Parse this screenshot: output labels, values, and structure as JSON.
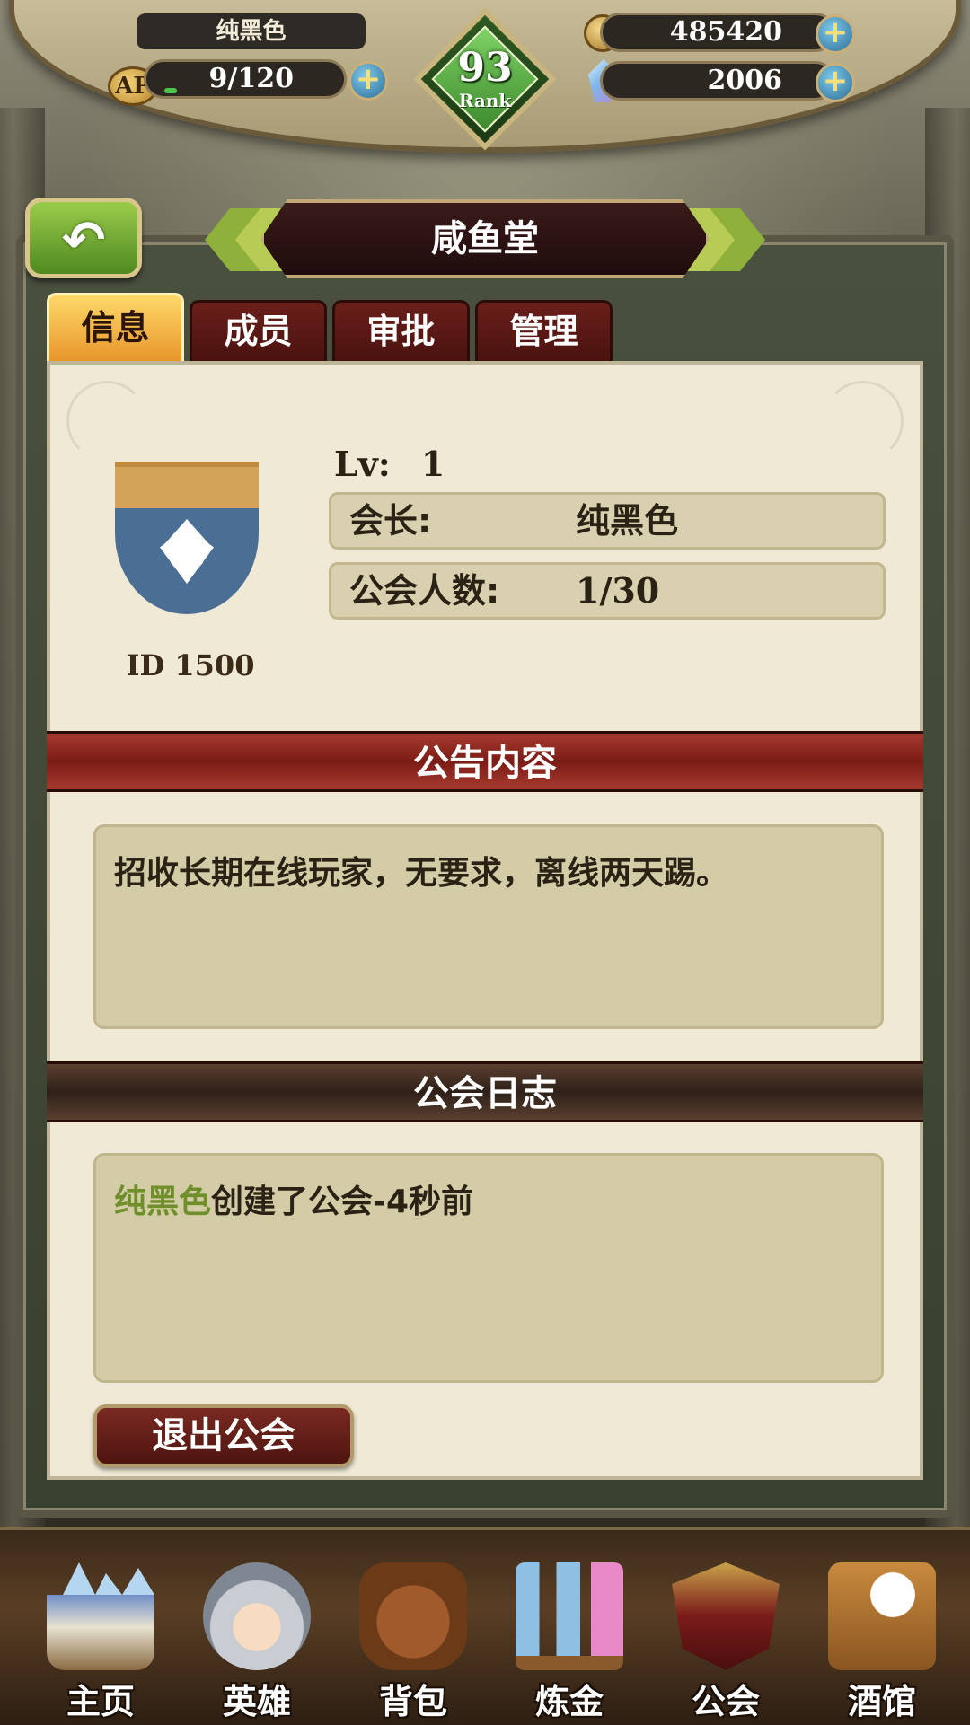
{
  "hud": {
    "player_name": "纯黑色",
    "ap_label": "AP",
    "ap_value": "9/120",
    "ap_fill_fraction": 0.075,
    "rank_number": "93",
    "rank_label": "Rank",
    "gold": "485420",
    "gems": "2006",
    "plus_symbol": "+"
  },
  "header": {
    "back_symbol": "↶",
    "title": "咸鱼堂"
  },
  "tabs": [
    {
      "label": "信息",
      "active": true
    },
    {
      "label": "成员",
      "active": false
    },
    {
      "label": "审批",
      "active": false
    },
    {
      "label": "管理",
      "active": false
    }
  ],
  "guild": {
    "id_text": "ID 1500",
    "level_label": "Lv:",
    "level_value": "1",
    "leader_label": "会长:",
    "leader_value": "纯黑色",
    "members_label": "公会人数:",
    "members_value": "1/30"
  },
  "notice": {
    "heading": "公告内容",
    "text": "招收长期在线玩家，无要求，离线两天踢。"
  },
  "log": {
    "heading": "公会日志",
    "entries": [
      {
        "user": "纯黑色",
        "text": "创建了公会-4秒前"
      }
    ]
  },
  "actions": {
    "quit_label": "退出公会"
  },
  "bottom_nav": [
    {
      "label": "主页",
      "icon": "castle-icon"
    },
    {
      "label": "英雄",
      "icon": "knight-helmet-icon"
    },
    {
      "label": "背包",
      "icon": "satchel-icon"
    },
    {
      "label": "炼金",
      "icon": "potion-rack-icon"
    },
    {
      "label": "公会",
      "icon": "guild-shield-icon"
    },
    {
      "label": "酒馆",
      "icon": "tavern-food-icon"
    }
  ],
  "colors": {
    "log_user": "#6e8f2a",
    "tab_active": "#e8962a",
    "tab_inactive": "#6a1f1a"
  }
}
